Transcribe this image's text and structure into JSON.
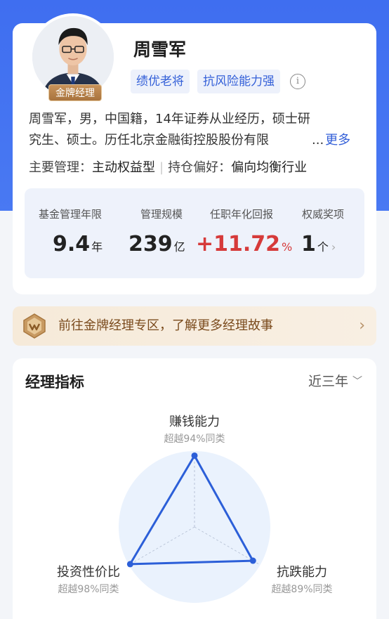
{
  "manager": {
    "name": "周雪军",
    "badge": "金牌经理",
    "tags": [
      "绩优老将",
      "抗风险能力强"
    ],
    "bio_lines": [
      "周雪军，男，中国籍，14年证券从业经历，硕士研",
      "究生、硕士。历任北京金融街控股股份有限"
    ],
    "more_dots": "...",
    "more_label": "更多",
    "main_manage_key": "主要管理：",
    "main_manage_val": "主动权益型",
    "holding_key": "持仓偏好：",
    "holding_val": "偏向均衡行业"
  },
  "stats": [
    {
      "label": "基金管理年限",
      "value": "9.4",
      "unit": "年"
    },
    {
      "label": "管理规模",
      "value": "239",
      "unit": "亿"
    },
    {
      "label": "任职年化回报",
      "value": "+11.72",
      "unit": "%"
    },
    {
      "label": "权威奖项",
      "value": "1",
      "unit": "个"
    }
  ],
  "promo": {
    "text": "前往金牌经理专区，了解更多经理故事"
  },
  "metrics": {
    "title": "经理指标",
    "period": "近三年",
    "axes": [
      {
        "name": "赚钱能力",
        "sub": "超越94%同类",
        "score": 0.94
      },
      {
        "name": "抗跌能力",
        "sub": "超越89%同类",
        "score": 0.89
      },
      {
        "name": "投资性价比",
        "sub": "超越98%同类",
        "score": 0.98
      }
    ]
  },
  "colors": {
    "brand_blue": "#3f6ef0",
    "tag_text": "#3460d8",
    "positive_red": "#d63a3a",
    "radar_line": "#2c5fd8",
    "radar_bg": "#eaf2fd",
    "promo_text": "#7a4a1c"
  }
}
